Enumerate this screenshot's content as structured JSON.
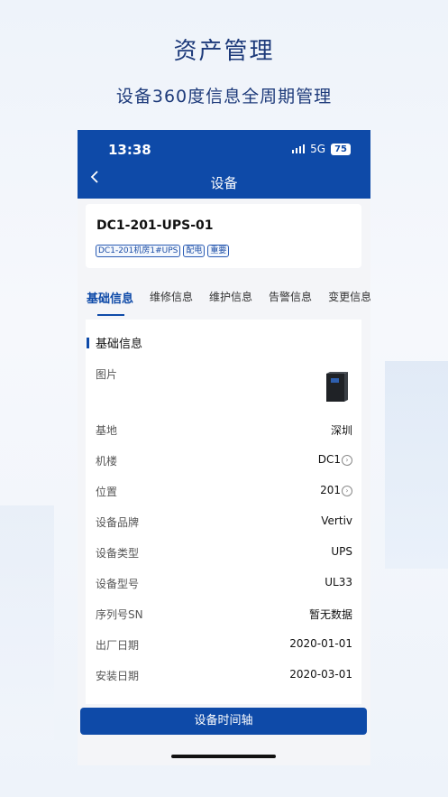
{
  "promo": {
    "title": "资产管理",
    "subtitle": "设备360度信息全周期管理"
  },
  "status_bar": {
    "time": "13:38",
    "network": "5G",
    "battery": "75"
  },
  "nav": {
    "title": "设备"
  },
  "device": {
    "name": "DC1-201-UPS-01",
    "tags": [
      "DC1-201机房1#UPS",
      "配电",
      "重要"
    ]
  },
  "tabs": [
    "基础信息",
    "维修信息",
    "维护信息",
    "告警信息",
    "变更信息"
  ],
  "section_title": "基础信息",
  "fields": [
    {
      "label": "图片",
      "value": ""
    },
    {
      "label": "基地",
      "value": "深圳"
    },
    {
      "label": "机楼",
      "value": "DC1"
    },
    {
      "label": "位置",
      "value": "201"
    },
    {
      "label": "设备品牌",
      "value": "Vertiv"
    },
    {
      "label": "设备类型",
      "value": "UPS"
    },
    {
      "label": "设备型号",
      "value": "UL33"
    },
    {
      "label": "序列号SN",
      "value": "暂无数据"
    },
    {
      "label": "出厂日期",
      "value": "2020-01-01"
    },
    {
      "label": "安装日期",
      "value": "2020-03-01"
    }
  ],
  "bottom_button": "设备时间轴",
  "colors": {
    "primary": "#0e4aa8",
    "title": "#1d3a7a"
  }
}
